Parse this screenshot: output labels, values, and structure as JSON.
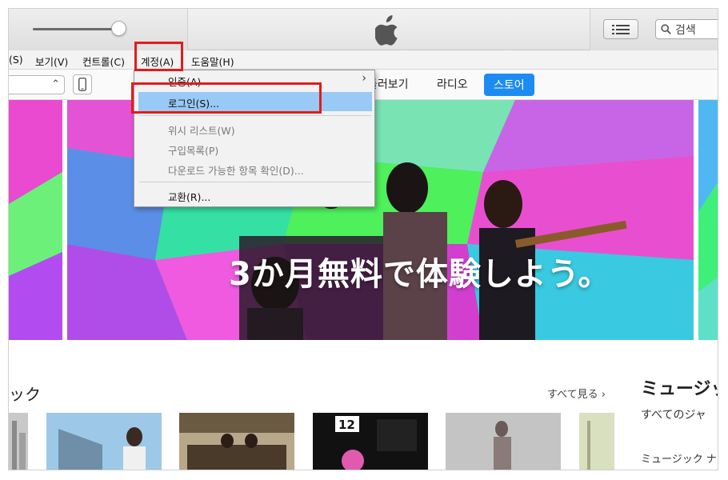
{
  "search": {
    "placeholder": "검색"
  },
  "menubar": {
    "items": [
      "(S)",
      "보기(V)",
      "컨트롤(C)",
      "계정(A)",
      "도움말(H)"
    ]
  },
  "account_menu": {
    "items": [
      {
        "label": "인증(A)",
        "has_submenu": true,
        "disabled": false
      },
      {
        "label": "로그인(S)...",
        "highlighted": true,
        "disabled": false
      },
      {
        "label": "위시 리스트(W)",
        "disabled": true
      },
      {
        "label": "구입목록(P)",
        "disabled": true
      },
      {
        "label": "다운로드 가능한 항목 확인(D)...",
        "disabled": true
      },
      {
        "label": "교환(R)...",
        "disabled": false
      }
    ]
  },
  "nav": {
    "tabs": [
      "둘러보기",
      "라디오",
      "스토어"
    ],
    "active_tab": "스토어"
  },
  "banner": {
    "headline": "3か月無料で体験しよう。"
  },
  "section": {
    "title": "ック",
    "see_all": "すべて見る ›"
  },
  "side_panel": {
    "title": "ミュージッ",
    "subtitle": "すべてのジャ",
    "item": "ミュージック ナ"
  },
  "album_art": {
    "label": "12"
  },
  "colors": {
    "accent": "#1d8cf2",
    "highlight": "#99c9f5",
    "annotation": "#e21b1b"
  }
}
